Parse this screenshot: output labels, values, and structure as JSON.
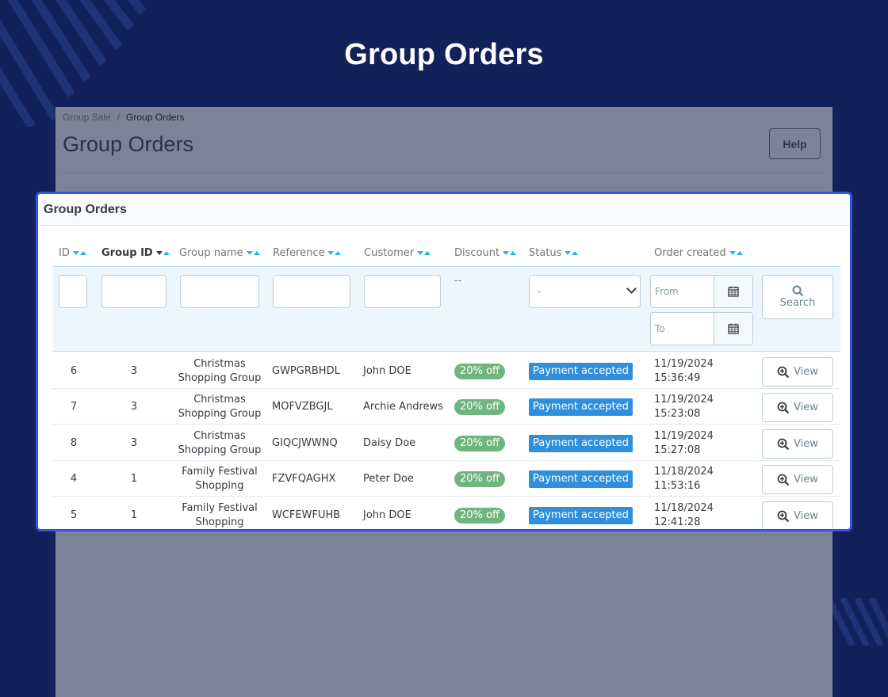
{
  "hero": {
    "title": "Group Orders"
  },
  "breadcrumb": {
    "parent": "Group Sale",
    "separator": "/",
    "current": "Group Orders"
  },
  "page": {
    "title": "Group Orders",
    "help_label": "Help"
  },
  "card": {
    "title": "Group Orders"
  },
  "columns": [
    "ID",
    "Group ID",
    "Group name",
    "Reference",
    "Customer",
    "Discount",
    "Status",
    "Order created"
  ],
  "filters": {
    "discount_placeholder": "--",
    "status_selected": "-",
    "date_from_placeholder": "From",
    "date_to_placeholder": "To",
    "search_label": "Search"
  },
  "rows": [
    {
      "id": "6",
      "group_id": "3",
      "group_name": "Christmas Shopping Group",
      "reference": "GWPGRBHDL",
      "customer": "John DOE",
      "discount": "20% off",
      "status": "Payment accepted",
      "date": "11/19/2024",
      "time": "15:36:49",
      "action": "View"
    },
    {
      "id": "7",
      "group_id": "3",
      "group_name": "Christmas Shopping Group",
      "reference": "MOFVZBGJL",
      "customer": "Archie Andrews",
      "discount": "20% off",
      "status": "Payment accepted",
      "date": "11/19/2024",
      "time": "15:23:08",
      "action": "View"
    },
    {
      "id": "8",
      "group_id": "3",
      "group_name": "Christmas Shopping Group",
      "reference": "GIQCJWWNQ",
      "customer": "Daisy Doe",
      "discount": "20% off",
      "status": "Payment accepted",
      "date": "11/19/2024",
      "time": "15:27:08",
      "action": "View"
    },
    {
      "id": "4",
      "group_id": "1",
      "group_name": "Family Festival Shopping",
      "reference": "FZVFQAGHX",
      "customer": "Peter Doe",
      "discount": "20% off",
      "status": "Payment accepted",
      "date": "11/18/2024",
      "time": "11:53:16",
      "action": "View"
    },
    {
      "id": "5",
      "group_id": "1",
      "group_name": "Family Festival Shopping",
      "reference": "WCFEWFUHB",
      "customer": "John DOE",
      "discount": "20% off",
      "status": "Payment accepted",
      "date": "11/18/2024",
      "time": "12:41:28",
      "action": "View"
    }
  ],
  "colors": {
    "background": "#13215a",
    "card_border": "#3454e0",
    "sort_arrow": "#25b9d7",
    "discount_badge": "#70b580",
    "status_badge": "#2f8fdc"
  },
  "icons": {
    "sort": "sort-arrows-icon",
    "calendar": "calendar-icon",
    "search": "search-icon",
    "view": "zoom-in-icon"
  }
}
